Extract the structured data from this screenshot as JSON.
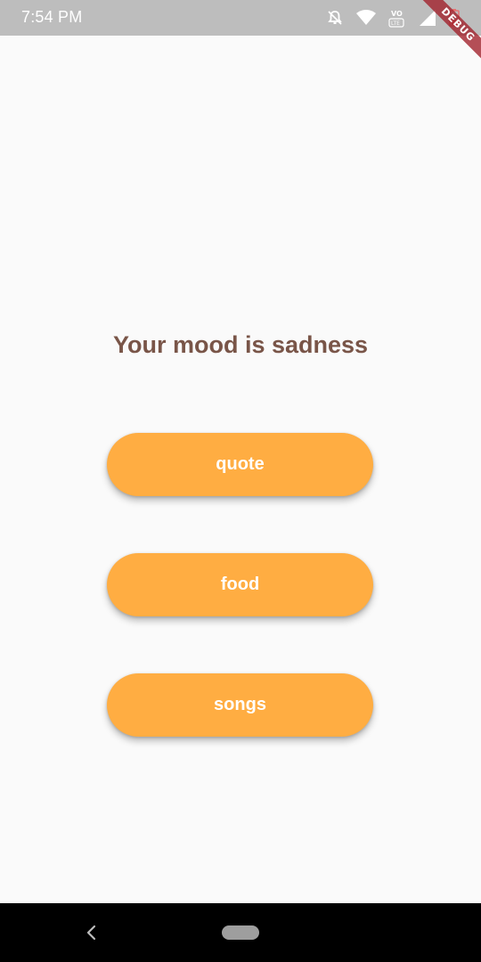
{
  "status_bar": {
    "time": "7:54 PM",
    "icons": [
      "notifications-off-icon",
      "wifi-icon",
      "volte-icon",
      "signal-icon",
      "battery-icon"
    ]
  },
  "debug_banner": {
    "label": "DEBUG"
  },
  "main": {
    "title": "Your mood is sadness",
    "buttons": [
      {
        "label": "quote"
      },
      {
        "label": "food"
      },
      {
        "label": "songs"
      }
    ]
  },
  "nav_bar": {
    "icons": [
      "back-icon",
      "home-pill-icon"
    ]
  },
  "colors": {
    "accent": "#ffad42",
    "title": "#795548",
    "background": "#fafafa",
    "status_bar": "#bdbdbd"
  }
}
